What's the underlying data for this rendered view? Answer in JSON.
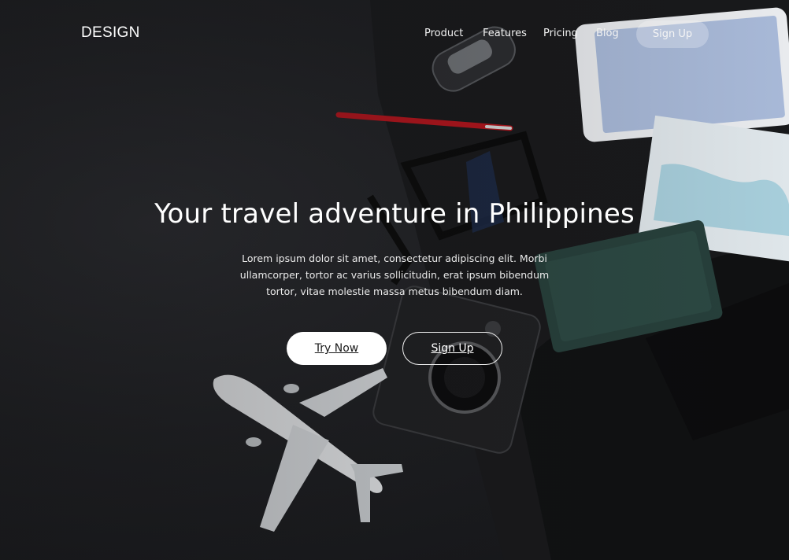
{
  "brand": {
    "logo": "DESIGN"
  },
  "nav": {
    "items": [
      {
        "label": "Product"
      },
      {
        "label": "Features"
      },
      {
        "label": "Pricing"
      },
      {
        "label": "Blog"
      }
    ],
    "cta_label": "Sign Up"
  },
  "hero": {
    "headline": "Your travel adventure in Philippines",
    "body": "Lorem ipsum dolor sit amet, consectetur adipiscing elit. Morbi ullamcorper, tortor ac varius sollicitudin, erat ipsum bibendum tortor, vitae molestie massa metus bibendum diam.",
    "primary_cta": "Try Now",
    "secondary_cta": "Sign Up"
  },
  "colors": {
    "background": "#1c1d20",
    "text": "#ffffff",
    "primary_button_bg": "#ffffff",
    "primary_button_text": "#1b1b1b",
    "nav_cta_bg": "rgba(255,255,255,0.26)"
  },
  "background_image": {
    "icons": [
      "airplane-model-icon",
      "camera-icon",
      "sunglasses-icon",
      "pen-icon",
      "car-key-icon",
      "smartphone-icon",
      "map-icon",
      "wallet-icon",
      "backpack-icon"
    ]
  }
}
